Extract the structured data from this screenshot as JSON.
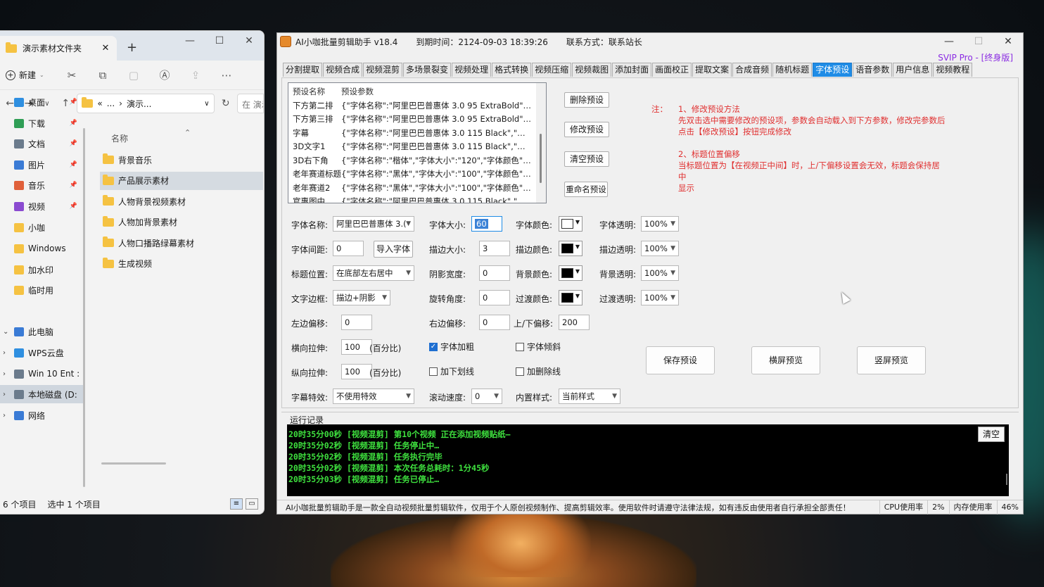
{
  "explorer": {
    "tab_title": "演示素材文件夹",
    "new_tab": "+",
    "toolbar": {
      "new_label": "新建"
    },
    "address": {
      "prefix": "«",
      "ellipsis": "...",
      "current": "演示...",
      "search_placeholder": "在 演示"
    },
    "column_header": "名称",
    "nav_items": [
      {
        "label": "桌面",
        "color": "#2f8fe0",
        "pinned": true
      },
      {
        "label": "下载",
        "color": "#2f9e55",
        "pinned": true
      },
      {
        "label": "文档",
        "color": "#6b7b8c",
        "pinned": true
      },
      {
        "label": "图片",
        "color": "#3a7bd5",
        "pinned": true
      },
      {
        "label": "音乐",
        "color": "#e0603a",
        "pinned": true
      },
      {
        "label": "视频",
        "color": "#8a4ad0",
        "pinned": true
      },
      {
        "label": "小咖",
        "color": "#f5c242",
        "pinned": false
      },
      {
        "label": "Windows",
        "color": "#f5c242",
        "pinned": false
      },
      {
        "label": "加水印",
        "color": "#f5c242",
        "pinned": false
      },
      {
        "label": "临时用",
        "color": "#f5c242",
        "pinned": false
      },
      {
        "label": "此电脑",
        "color": "#3a7bd5",
        "pinned": false
      },
      {
        "label": "WPS云盘",
        "color": "#2f8fe0",
        "pinned": false
      },
      {
        "label": "Win 10 Ent :",
        "color": "#6b7b8c",
        "pinned": false
      },
      {
        "label": "本地磁盘 (D:",
        "color": "#6b7b8c",
        "pinned": false
      },
      {
        "label": "网络",
        "color": "#3a7bd5",
        "pinned": false
      }
    ],
    "files": [
      "背景音乐",
      "产品展示素材",
      "人物背景视频素材",
      "人物加背景素材",
      "人物口播路绿幕素材",
      "生成视频"
    ],
    "status": {
      "count": "6 个项目",
      "selected": "选中 1 个项目"
    }
  },
  "app": {
    "title": "AI小咖批量剪辑助手 v18.4",
    "expire": "到期时间：2124-09-03 18:39:26",
    "contact": "联系方式：联系站长",
    "svip": "SVIP Pro - [终身版]",
    "tabs": [
      "分割提取",
      "视频合成",
      "视频混剪",
      "多场景裂变",
      "视频处理",
      "格式转换",
      "视频压缩",
      "视频裁图",
      "添加封面",
      "画面校正",
      "提取文案",
      "合成音频",
      "随机标题",
      "字体预设",
      "语音参数",
      "用户信息",
      "视频教程"
    ],
    "active_tab": "字体预设",
    "preset_list": {
      "col1": "预设名称",
      "col2": "预设参数",
      "rows": [
        {
          "name": "下方第二排",
          "params": "{\"字体名称\":\"阿里巴巴普惠体 3.0 95 ExtraBold\",\"字..."
        },
        {
          "name": "下方第三排",
          "params": "{\"字体名称\":\"阿里巴巴普惠体 3.0 95 ExtraBold\",\"字..."
        },
        {
          "name": "字幕",
          "params": "{\"字体名称\":\"阿里巴巴普惠体 3.0 115 Black\",\"字体..."
        },
        {
          "name": "3D文字1",
          "params": "{\"字体名称\":\"阿里巴巴普惠体 3.0 115 Black\",\"字体..."
        },
        {
          "name": "3D右下角",
          "params": "{\"字体名称\":\"楷体\",\"字体大小\":\"120\",\"字体颜色\":\"25..."
        },
        {
          "name": "老年赛道标题",
          "params": "{\"字体名称\":\"黑体\",\"字体大小\":\"100\",\"字体颜色\":\"65..."
        },
        {
          "name": "老年赛道2",
          "params": "{\"字体名称\":\"黑体\",\"字体大小\":\"100\",\"字体颜色\":\"25..."
        },
        {
          "name": "官惠图中",
          "params": "{\"字体名称\":\"阿里巴巴普惠体 3.0 115 Black\",\"字体..."
        }
      ]
    },
    "preset_buttons": [
      "删除预设",
      "修改预设",
      "清空预设",
      "重命名预设"
    ],
    "note": {
      "label": "注：",
      "lines": [
        "1、修改预设方法",
        "先双击选中需要修改的预设项，参数会自动载入到下方参数，修改完参数后",
        "点击【修改预设】按钮完成修改",
        "",
        "2、标题位置偏移",
        "当标题位置为【在视频正中间】时，上/下偏移设置会无效，标题会保持居中",
        "显示"
      ]
    },
    "form": {
      "font_name": {
        "label": "字体名称:",
        "value": "阿里巴巴普惠体 3.("
      },
      "font_size": {
        "label": "字体大小:",
        "value": "60"
      },
      "font_color": {
        "label": "字体颜色:",
        "color": "#ffffff"
      },
      "font_opacity": {
        "label": "字体透明:",
        "value": "100%"
      },
      "spacing": {
        "label": "字体间距:",
        "value": "0"
      },
      "import_font": "导入字体",
      "stroke_size": {
        "label": "描边大小:",
        "value": "3"
      },
      "stroke_color": {
        "label": "描边颜色:",
        "color": "#000000"
      },
      "stroke_opacity": {
        "label": "描边透明:",
        "value": "100%"
      },
      "title_pos": {
        "label": "标题位置:",
        "value": "在底部左右居中"
      },
      "shadow_width": {
        "label": "阴影宽度:",
        "value": "0"
      },
      "bg_color": {
        "label": "背景颜色:",
        "color": "#000000"
      },
      "bg_opacity": {
        "label": "背景透明:",
        "value": "100%"
      },
      "text_border": {
        "label": "文字边框:",
        "value": "描边+阴影"
      },
      "rotation": {
        "label": "旋转角度:",
        "value": "0"
      },
      "trans_color": {
        "label": "过渡颜色:",
        "color": "#000000"
      },
      "trans_opacity": {
        "label": "过渡透明:",
        "value": "100%"
      },
      "left_offset": {
        "label": "左边偏移:",
        "value": "0"
      },
      "right_offset": {
        "label": "右边偏移:",
        "value": "0"
      },
      "vert_offset": {
        "label": "上/下偏移:",
        "value": "200"
      },
      "h_stretch": {
        "label": "横向拉伸:",
        "value": "100",
        "unit": "(百分比)"
      },
      "v_stretch": {
        "label": "纵向拉伸:",
        "value": "100",
        "unit": "(百分比)"
      },
      "bold": {
        "label": "字体加粗",
        "checked": true
      },
      "italic": {
        "label": "字体倾斜",
        "checked": false
      },
      "underline": {
        "label": "加下划线",
        "checked": false
      },
      "strike": {
        "label": "加删除线",
        "checked": false
      },
      "effect": {
        "label": "字幕特效:",
        "value": "不使用特效"
      },
      "scroll_speed": {
        "label": "滚动速度:",
        "value": "0"
      },
      "builtin_style": {
        "label": "内置样式:",
        "value": "当前样式"
      },
      "save_btn": "保存预设",
      "landscape_btn": "横屏预览",
      "portrait_btn": "竖屏预览"
    },
    "log": {
      "title": "运行记录",
      "clear": "清空",
      "lines": [
        "20时35分00秒 [视频混剪] 第10个视频 正在添加视频贴纸—",
        "20时35分02秒 [视频混剪] 任务停止中…",
        "20时35分02秒 [视频混剪] 任务执行完毕",
        "20时35分02秒 [视频混剪] 本次任务总耗时：1分45秒",
        "20时35分03秒 [视频混剪] 任务已停止…"
      ]
    },
    "statusbar": {
      "message": "AI小咖批量剪辑助手是一款全自动视频批量剪辑软件，仅用于个人原创视频制作、提高剪辑效率。使用软件时请遵守法律法规，如有违反由使用者自行承担全部责任！",
      "cpu_label": "CPU使用率",
      "cpu_value": "2%",
      "mem_label": "内存使用率",
      "mem_value": "46%"
    }
  }
}
